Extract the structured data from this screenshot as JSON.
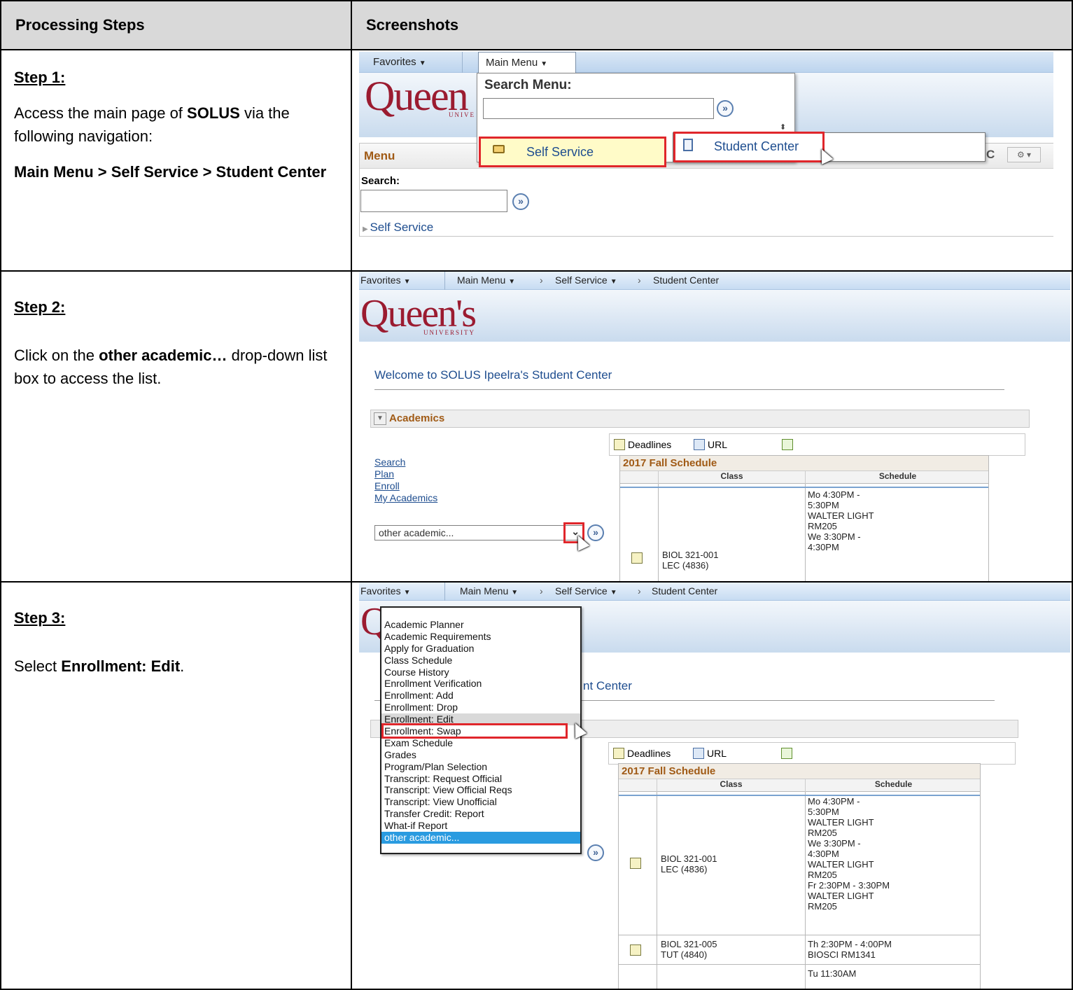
{
  "headers": {
    "steps": "Processing Steps",
    "screenshots": "Screenshots"
  },
  "steps": [
    {
      "title": "Step 1:",
      "text_pre": "Access the main page of ",
      "text_bold": "SOLUS",
      "text_post": " via the following navigation:",
      "path": "Main Menu > Self Service > Student Center"
    },
    {
      "title": "Step 2:",
      "text_pre": "Click on the ",
      "text_bold": "other academic…",
      "text_post": " drop-down list box to access the list."
    },
    {
      "title": "Step 3:",
      "text_pre": "Select ",
      "text_bold": "Enrollment: Edit",
      "text_post": "."
    }
  ],
  "shot1": {
    "favorites": "Favorites",
    "main_menu": "Main Menu",
    "search_menu": "Search Menu:",
    "self_service": "Self Service",
    "student_center": "Student Center",
    "menu_title": "Menu",
    "search_label": "Search:",
    "self_service_link": "Self Service",
    "logo": "Queen",
    "logo_sub": "UNIVE",
    "partial_c": "C"
  },
  "shot2": {
    "favorites": "Favorites",
    "main_menu": "Main Menu",
    "self_service": "Self Service",
    "student_center": "Student Center",
    "logo": "Queen's",
    "logo_sub": "UNIVERSITY",
    "welcome": "Welcome to SOLUS Ipeelra's Student Center",
    "academics": "Academics",
    "toolbar": {
      "deadlines": "Deadlines",
      "url": "URL"
    },
    "links": [
      "Search",
      "Plan",
      "Enroll",
      "My Academics"
    ],
    "select_value": "other academic...",
    "schedule_title": "2017 Fall Schedule",
    "col_class": "Class",
    "col_schedule": "Schedule",
    "row1_class": "BIOL 321-001\nLEC (4836)",
    "row1_schedule": "Mo 4:30PM -\n5:30PM\nWALTER LIGHT\nRM205\nWe 3:30PM -\n4:30PM"
  },
  "shot3": {
    "favorites": "Favorites",
    "main_menu": "Main Menu",
    "self_service": "Self Service",
    "student_center": "Student Center",
    "welcome_tail": "nt Center",
    "toolbar": {
      "deadlines": "Deadlines",
      "url": "URL"
    },
    "options": [
      "Academic Planner",
      "Academic Requirements",
      "Apply for Graduation",
      "Class Schedule",
      "Course History",
      "Enrollment Verification",
      "Enrollment: Add",
      "Enrollment: Drop",
      "Enrollment: Edit",
      "Enrollment: Swap",
      "Exam Schedule",
      "Grades",
      "Program/Plan Selection",
      "Transcript: Request Official",
      "Transcript: View Official Reqs",
      "Transcript: View Unofficial",
      "Transfer Credit: Report",
      "What-if Report",
      "other academic..."
    ],
    "schedule_title": "2017 Fall Schedule",
    "col_class": "Class",
    "col_schedule": "Schedule",
    "row1_class": "BIOL 321-001\nLEC (4836)",
    "row1_schedule": "Mo 4:30PM -\n5:30PM\nWALTER LIGHT\nRM205\nWe 3:30PM -\n4:30PM\nWALTER LIGHT\nRM205\nFr 2:30PM - 3:30PM\nWALTER LIGHT\nRM205",
    "row2_class": "BIOL 321-005\nTUT (4840)",
    "row2_schedule": "Th 2:30PM - 4:00PM\nBIOSCI RM1341",
    "row3_partial": "Tu 11:30AM"
  }
}
